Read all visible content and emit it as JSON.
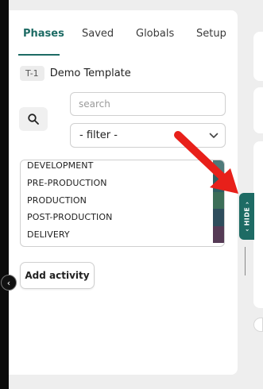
{
  "tabs": [
    "Phases",
    "Saved",
    "Globals",
    "Setup"
  ],
  "template": {
    "badge": "T-1",
    "name": "Demo Template"
  },
  "search": {
    "placeholder": "search",
    "value": ""
  },
  "filter": {
    "selected": "- filter -"
  },
  "phases": [
    {
      "label": "DEVELOPMENT",
      "color": "#4f7a7a"
    },
    {
      "label": "PRE-PRODUCTION",
      "color": "#2f5e62"
    },
    {
      "label": "PRODUCTION",
      "color": "#3c6e58"
    },
    {
      "label": "POST-PRODUCTION",
      "color": "#2e4d5c"
    },
    {
      "label": "DELIVERY",
      "color": "#553a55"
    }
  ],
  "add_activity_label": "Add activity",
  "hide_label": "HIDE",
  "colors": {
    "accent": "#1d6b64",
    "arrow": "#e8201a"
  }
}
